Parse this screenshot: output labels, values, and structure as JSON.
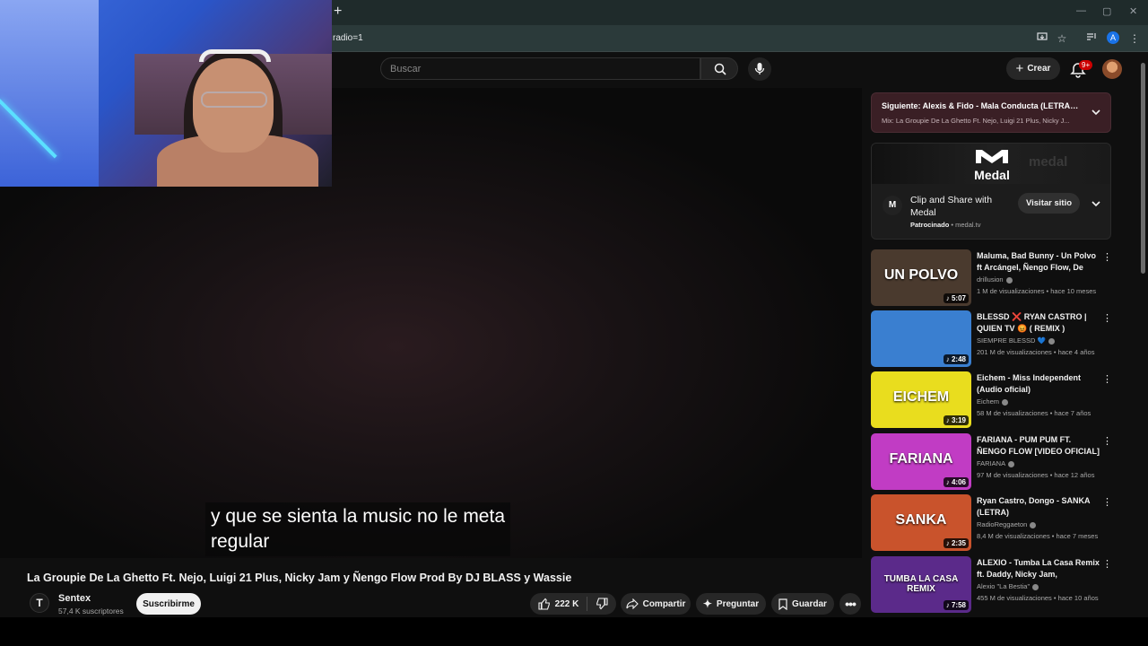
{
  "browser": {
    "new_tab_symbol": "+",
    "url_fragment": "radio=1",
    "window_controls": [
      "—",
      "▢",
      "✕"
    ],
    "account_initial": "A"
  },
  "header": {
    "search_placeholder": "Buscar",
    "create_label": "Crear",
    "notification_count": "9+"
  },
  "player": {
    "subtitle_line1": "y que se sienta la music no le meta",
    "subtitle_line2": "regular"
  },
  "video": {
    "title": "La Groupie De La Ghetto Ft. Nejo, Luigi 21 Plus, Nicky Jam y Ñengo Flow Prod By DJ BLASS y Wassie",
    "channel_name": "Sentex",
    "channel_subscribers": "57,4 K suscriptores",
    "channel_avatar_letter": "T",
    "subscribe_label": "Suscribirme",
    "likes": "222 K",
    "share_label": "Compartir",
    "ask_label": "Preguntar",
    "save_label": "Guardar"
  },
  "next_up": {
    "title": "Siguiente: Alexis & Fido - Mala Conducta (LETRA) ft...",
    "subtitle": "Mix: La Groupie De La Ghetto Ft. Nejo, Luigi 21 Plus, Nicky J..."
  },
  "ad": {
    "banner_logo": "Medal",
    "banner_faint_text": "medal",
    "icon_letter": "M",
    "title": "Clip and Share with Medal",
    "sponsored_label": "Patrocinado",
    "domain": "medal.tv",
    "visit_label": "Visitar sitio"
  },
  "recommendations": [
    {
      "title": "Maluma, Bad Bunny - Un Polvo ft Arcángel, Ñengo Flow, De La...",
      "channel": "drillusion",
      "stats": "1 M de visualizaciones • hace 10 meses",
      "duration": "5:07",
      "thumb_text": "UN POLVO",
      "thumb_bg": "#4a3a2e"
    },
    {
      "title": "BLESSD ❌ RYAN CASTRO | QUIEN TV 😡 ( REMIX )",
      "channel": "SIEMPRE BLESSD 💙",
      "stats": "201 M de visualizaciones • hace 4 años",
      "duration": "2:48",
      "thumb_text": "",
      "thumb_bg": "#3a7fd0"
    },
    {
      "title": "Eichem - Miss Independent (Audio oficial)",
      "channel": "Eichem",
      "stats": "58 M de visualizaciones • hace 7 años",
      "duration": "3:19",
      "thumb_text": "EICHEM",
      "thumb_bg": "#e9dd1e"
    },
    {
      "title": "FARIANA - PUM PUM FT. ÑENGO FLOW [VIDEO OFICIAL]",
      "channel": "FARIANA",
      "stats": "97 M de visualizaciones • hace 12 años",
      "duration": "4:06",
      "thumb_text": "FARIANA",
      "thumb_bg": "#c13cc4"
    },
    {
      "title": "Ryan Castro, Dongo - SANKA (LETRA)",
      "channel": "RadioReggaeton",
      "stats": "8,4 M de visualizaciones • hace 7 meses",
      "duration": "2:35",
      "thumb_text": "SANKA",
      "thumb_bg": "#c9532c"
    },
    {
      "title": "ALEXIO - Tumba La Casa Remix ft. Daddy, Nicky Jam, Arcangel...",
      "channel": "Alexio \"La Bestia\"",
      "stats": "455 M de visualizaciones • hace 10 años",
      "duration": "7:58",
      "thumb_text": "TUMBA LA CASA REMIX",
      "thumb_bg": "#5b2a8a"
    }
  ],
  "colors": {
    "background": "#0f0f0f",
    "next_card": "#3a1f25",
    "subscribe_bg": "#f1f1f1",
    "badge": "#cc0000"
  }
}
